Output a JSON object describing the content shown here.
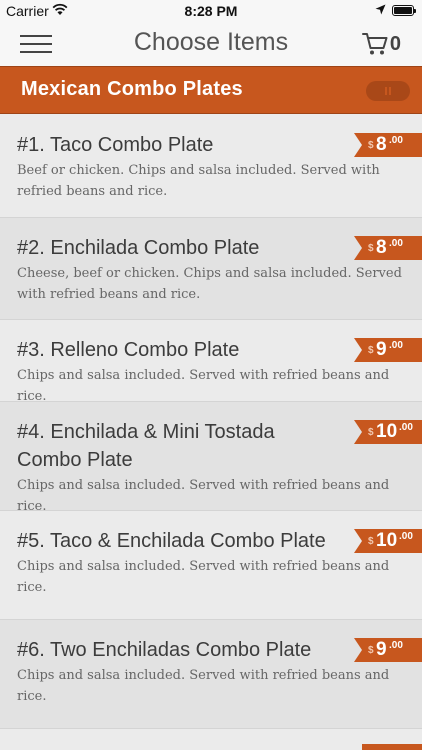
{
  "status_bar": {
    "carrier": "Carrier",
    "time": "8:28 PM"
  },
  "nav": {
    "title": "Choose Items",
    "cart_count": "0"
  },
  "category": {
    "title": "Mexican Combo Plates"
  },
  "colors": {
    "accent": "#c7571e",
    "header_bg": "#f7f7f7",
    "row_odd": "#ebebeb",
    "row_even": "#e2e2e2"
  },
  "items": [
    {
      "title": "#1. Taco Combo Plate",
      "desc": "Beef or chicken.  Chips and salsa included.  Served with refried beans and rice.",
      "currency": "$",
      "price": "8",
      "cents": ".00"
    },
    {
      "title": "#2. Enchilada Combo Plate",
      "desc": "Cheese, beef or chicken.  Chips and salsa included.  Served with refried beans and rice.",
      "currency": "$",
      "price": "8",
      "cents": ".00"
    },
    {
      "title": "#3. Relleno Combo Plate",
      "desc": "Chips and salsa included.  Served with refried beans and rice.",
      "currency": "$",
      "price": "9",
      "cents": ".00"
    },
    {
      "title": "#4. Enchilada & Mini Tostada Combo Plate",
      "desc": "Chips and salsa included.  Served with refried beans and rice.",
      "currency": "$",
      "price": "10",
      "cents": ".00"
    },
    {
      "title": "#5. Taco & Enchilada Combo Plate",
      "desc": "Chips and salsa included.  Served with refried beans and rice.",
      "currency": "$",
      "price": "10",
      "cents": ".00"
    },
    {
      "title": "#6. Two Enchiladas Combo Plate",
      "desc": "Chips and salsa included.  Served with refried beans and rice.",
      "currency": "$",
      "price": "9",
      "cents": ".00"
    }
  ]
}
